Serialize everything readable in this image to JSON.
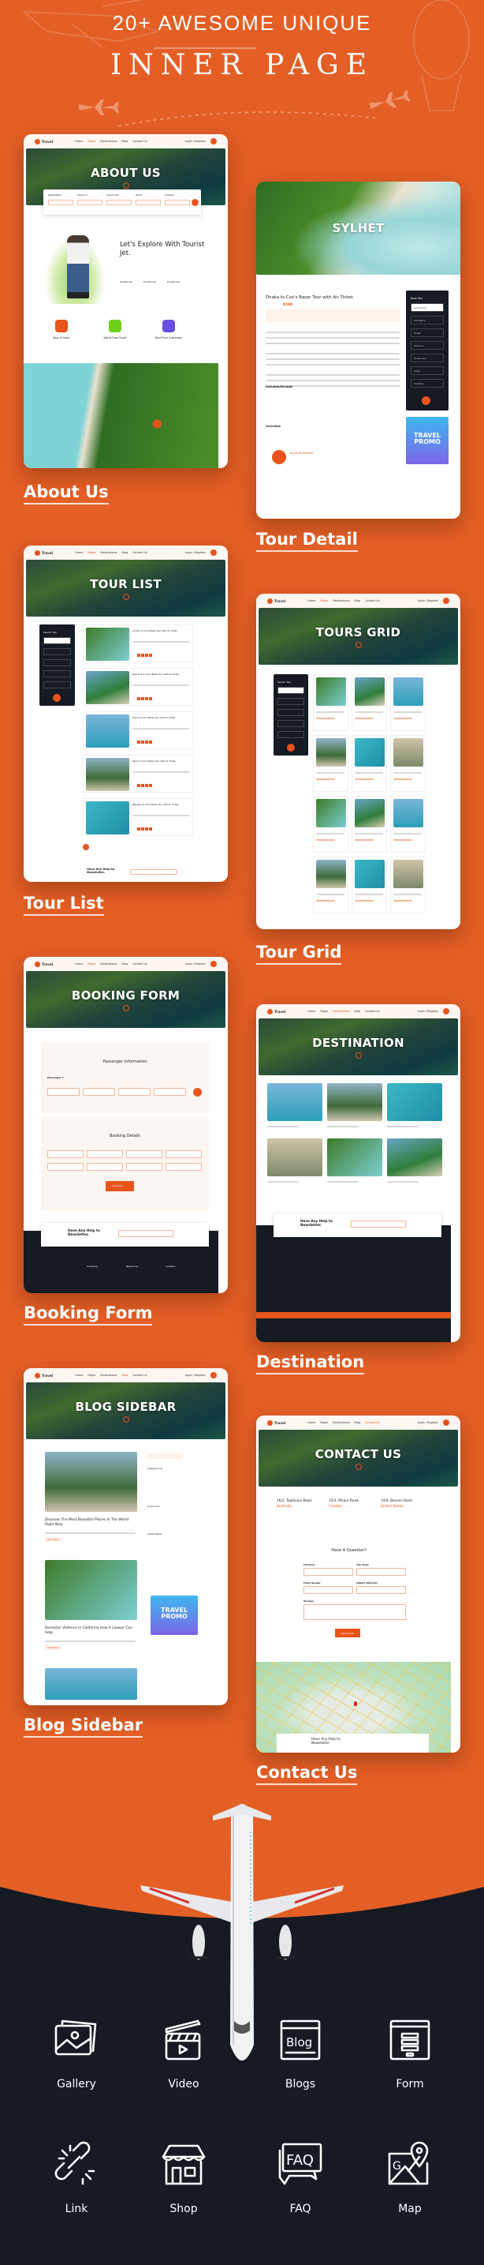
{
  "header": {
    "subtitle": "20+ AWESOME UNIQUE",
    "title": "INNER PAGE"
  },
  "nav": {
    "logo": "Travel",
    "items": [
      "Home",
      "Pages",
      "Destinations",
      "Blog",
      "Contact Us"
    ],
    "login": "Login / Register"
  },
  "colors": {
    "accent": "#e8541c",
    "background": "#e45f25",
    "dark": "#151a23"
  },
  "pages": [
    {
      "id": "about",
      "label": "About Us",
      "hero": "ABOUT US",
      "active": 1,
      "search": [
        "Destination",
        "Check In",
        "Check Out",
        "Adult",
        "Children"
      ],
      "heading": "Let's Explore With Tourist Jet.",
      "services": [
        "Private Car",
        "Private Car",
        "Private Car"
      ],
      "features": [
        "Best Of Hotel",
        "World Class Travel",
        "Best Price Guarantee"
      ]
    },
    {
      "id": "detail",
      "label": "Tour Detail",
      "hero": "SYLHET",
      "title": "Dhaka to Cox's Bazar Tour with Air Ticket.",
      "price": "€590",
      "book": "Book Tour",
      "fields": [
        "Destination",
        "Full Name",
        "Email",
        "Check In",
        "Check Out",
        "Adult",
        "Children"
      ],
      "include": "Included/Exclude",
      "overview": "Overview",
      "promo": "TRAVEL PROMO",
      "author": "Burak Ali Bedmal"
    },
    {
      "id": "list",
      "label": "Tour List",
      "hero": "TOUR LIST",
      "active": 1,
      "search": "Search Tour",
      "tours": [
        "London to Cox's Bazar Tour with Air Ticket.",
        "New York to Cox's Bazar Tour with Air Ticket.",
        "Tokyo to Cox's Bazar Tour with Air Ticket.",
        "Berlin to Cox's Bazar Tour with Air Ticket.",
        "Bangkok to Cox's Bazar Tour with Air Ticket."
      ],
      "newsletter": "Have Any Help to Newsletter."
    },
    {
      "id": "grid",
      "label": "Tour Grid",
      "hero": "TOURS GRID",
      "active": 1,
      "search": "Search Tour"
    },
    {
      "id": "booking",
      "label": "Booking Form",
      "hero": "BOOKING FORM",
      "active": 1,
      "passenger": "Passenger Information",
      "passenger1": "Passenger 1",
      "details": "Booking Details",
      "continue": "Continue",
      "newsletter": "Have Any Help to Newsletter.",
      "footer": [
        "Company",
        "Resources",
        "Location"
      ]
    },
    {
      "id": "destination",
      "label": "Destination",
      "hero": "DESTINATION",
      "active": 2,
      "newsletter": "Have Any Help to Newsletter."
    },
    {
      "id": "blog",
      "label": "Blog Sidebar",
      "hero": "BLOG SIDEBAR",
      "active": 3,
      "posts": [
        "Discover The Most Beautiful Places In The World Right Now",
        "Domestic Violence In California How A Lawyer Can Help"
      ],
      "read": "Read More",
      "category": "Category list",
      "social": "Social Icon",
      "latest": "Latest News",
      "promo": "TRAVEL PROMO"
    },
    {
      "id": "contact",
      "label": "Contact Us",
      "hero": "CONTACT US",
      "active": 4,
      "addresses": [
        {
          "street": "16/2, Topkhana Road,",
          "country": "Australia."
        },
        {
          "street": "15/3, Mirpur Road,",
          "country": "Canada."
        },
        {
          "street": "14/4, Bonosri Road,",
          "country": "United States."
        }
      ],
      "question": "Have A Question?",
      "form": [
        "Full Name",
        "Your Email",
        "Phone Number",
        "Subject (Optional)",
        "Message"
      ],
      "submit": "Submit Now",
      "newsletter": "Have Any Help to Newsletter."
    }
  ],
  "features": [
    {
      "label": "Gallery",
      "icon": "gallery-icon"
    },
    {
      "label": "Video",
      "icon": "video-icon"
    },
    {
      "label": "Blogs",
      "icon": "blog-icon"
    },
    {
      "label": "Form",
      "icon": "form-icon"
    },
    {
      "label": "Link",
      "icon": "link-icon"
    },
    {
      "label": "Shop",
      "icon": "shop-icon"
    },
    {
      "label": "FAQ",
      "icon": "faq-icon"
    },
    {
      "label": "Map",
      "icon": "map-icon"
    }
  ]
}
